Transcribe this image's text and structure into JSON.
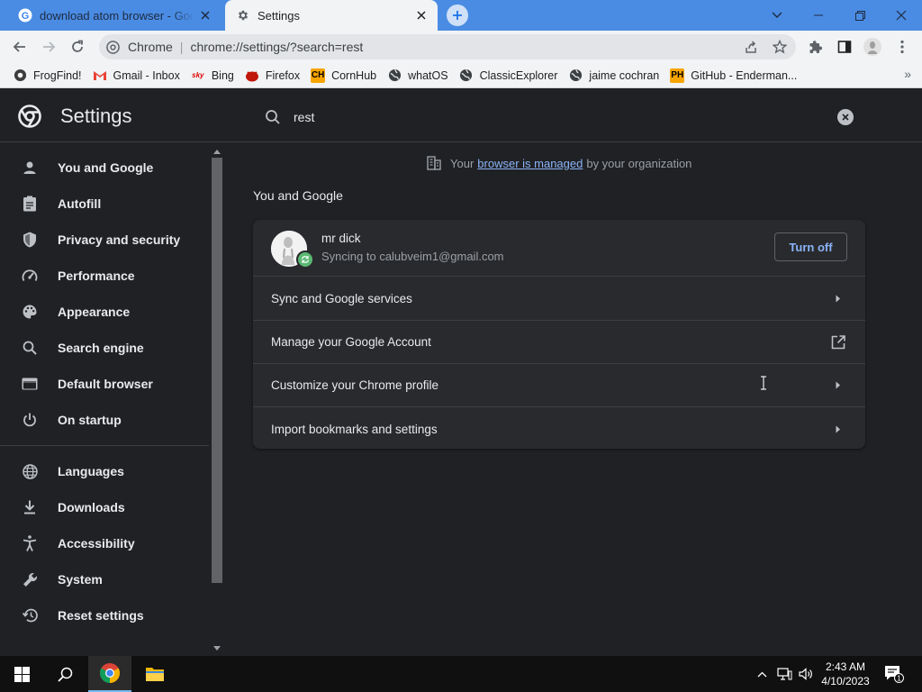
{
  "browser": {
    "tabs": [
      {
        "title": "download atom browser - Google Search",
        "active": false
      },
      {
        "title": "Settings",
        "active": true
      }
    ],
    "omnibox": {
      "chip": "Chrome",
      "url": "chrome://settings/?search=rest"
    },
    "bookmarks": [
      {
        "label": "FrogFind!",
        "icon": "frog-icon"
      },
      {
        "label": "Gmail - Inbox",
        "icon": "gmail-icon"
      },
      {
        "label": "Bing",
        "icon": "bing-icon"
      },
      {
        "label": "Firefox",
        "icon": "firefox-icon"
      },
      {
        "label": "CornHub",
        "icon": "cornhub-icon"
      },
      {
        "label": "whatOS",
        "icon": "globe-icon"
      },
      {
        "label": "ClassicExplorer",
        "icon": "globe-icon"
      },
      {
        "label": "jaime cochran",
        "icon": "globe-icon"
      },
      {
        "label": "GitHub - Enderman...",
        "icon": "github-icon"
      }
    ],
    "more_bookmarks": "»"
  },
  "settings": {
    "title": "Settings",
    "search_value": "rest",
    "nav": [
      {
        "label": "You and Google",
        "icon": "person-icon"
      },
      {
        "label": "Autofill",
        "icon": "clipboard-icon"
      },
      {
        "label": "Privacy and security",
        "icon": "shield-icon"
      },
      {
        "label": "Performance",
        "icon": "speedometer-icon"
      },
      {
        "label": "Appearance",
        "icon": "palette-icon"
      },
      {
        "label": "Search engine",
        "icon": "search-icon"
      },
      {
        "label": "Default browser",
        "icon": "browser-window-icon"
      },
      {
        "label": "On startup",
        "icon": "power-icon"
      },
      {
        "label": "Languages",
        "icon": "globe-icon"
      },
      {
        "label": "Downloads",
        "icon": "download-icon"
      },
      {
        "label": "Accessibility",
        "icon": "accessibility-icon"
      },
      {
        "label": "System",
        "icon": "wrench-icon"
      },
      {
        "label": "Reset settings",
        "icon": "reset-icon"
      }
    ],
    "managed": {
      "prefix": "Your",
      "link": "browser is managed",
      "suffix": "by your organization"
    },
    "section_title": "You and Google",
    "profile": {
      "name": "mr dick",
      "email": "Syncing to calubveim1@gmail.com",
      "turn_off": "Turn off"
    },
    "rows": [
      {
        "label": "Sync and Google services",
        "icon": "chevron-right-icon"
      },
      {
        "label": "Manage your Google Account",
        "icon": "external-link-icon"
      },
      {
        "label": "Customize your Chrome profile",
        "icon": "chevron-right-icon"
      },
      {
        "label": "Import bookmarks and settings",
        "icon": "chevron-right-icon"
      }
    ]
  },
  "taskbar": {
    "time": "2:43 AM",
    "date": "4/10/2023",
    "notification_count": "1"
  },
  "colors": {
    "accent": "#8ab4f8",
    "tabstrip": "#4a8ce3",
    "surface": "#202124",
    "card": "#292a2d"
  }
}
